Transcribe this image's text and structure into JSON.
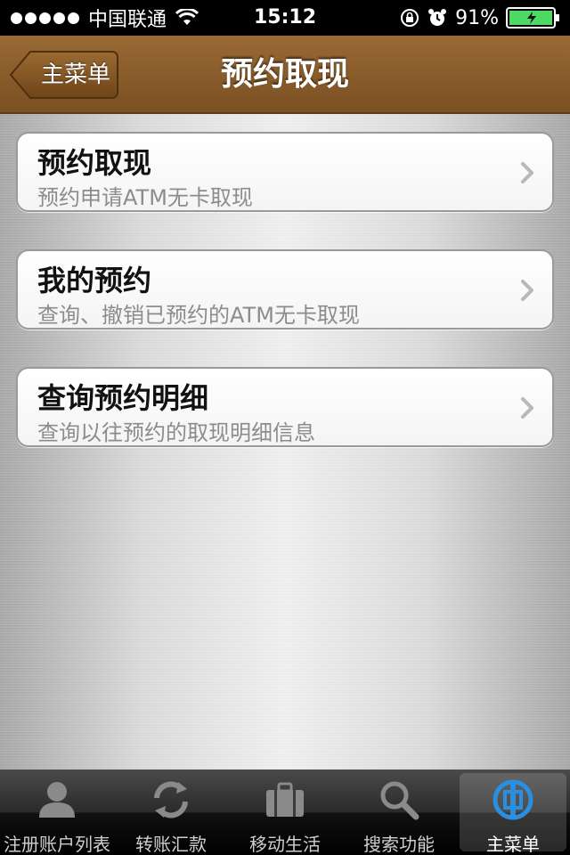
{
  "status_bar": {
    "carrier": "中国联通",
    "time": "15:12",
    "battery": "91%"
  },
  "nav": {
    "back_label": "主菜单",
    "title": "预约取现"
  },
  "menu": {
    "items": [
      {
        "title": "预约取现",
        "subtitle": "预约申请ATM无卡取现"
      },
      {
        "title": "我的预约",
        "subtitle": "查询、撤销已预约的ATM无卡取现"
      },
      {
        "title": "查询预约明细",
        "subtitle": "查询以往预约的取现明细信息"
      }
    ]
  },
  "tabs": {
    "items": [
      {
        "label": "注册账户列表",
        "icon": "person-icon"
      },
      {
        "label": "转账汇款",
        "icon": "refresh-icon"
      },
      {
        "label": "移动生活",
        "icon": "briefcase-icon"
      },
      {
        "label": "搜索功能",
        "icon": "search-icon"
      },
      {
        "label": "主菜单",
        "icon": "bank-logo-icon"
      }
    ]
  },
  "colors": {
    "nav_brown": "#8b5e2c",
    "battery_green": "#4cd964",
    "subtitle_gray": "#8c8c8c"
  }
}
